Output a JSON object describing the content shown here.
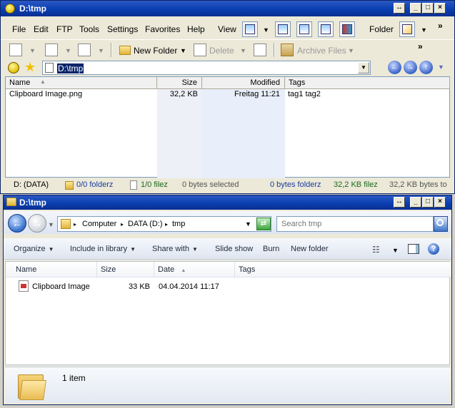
{
  "win1": {
    "title": "D:\\tmp",
    "menus": [
      "File",
      "Edit",
      "FTP",
      "Tools",
      "Settings",
      "Favorites",
      "Help",
      "View",
      "Folder"
    ],
    "toolbar": {
      "new_folder": "New Folder",
      "delete": "Delete",
      "archive_files": "Archive Files",
      "overflow": "»"
    },
    "address": {
      "path": "D:\\tmp"
    },
    "columns": [
      "Name",
      "Size",
      "Modified",
      "Tags"
    ],
    "rows": [
      {
        "name": "Clipboard Image.png",
        "size": "32,2 KB",
        "modified": "Freitag  11:21",
        "tags": "tag1 tag2"
      }
    ],
    "status": {
      "drive": "D: (DATA)",
      "folders": "0/0 folderz",
      "files": "1/0 filez",
      "selected": "0 bytes selected",
      "folder_bytes": "0 bytes folderz",
      "file_bytes": "32,2 KB filez",
      "total": "32,2 KB bytes to"
    }
  },
  "win2": {
    "title": "D:\\tmp",
    "breadcrumb": [
      "Computer",
      "DATA (D:)",
      "tmp"
    ],
    "search_placeholder": "Search tmp",
    "commands": {
      "organize": "Organize",
      "include": "Include in library",
      "share": "Share with",
      "slideshow": "Slide show",
      "burn": "Burn",
      "new_folder": "New folder"
    },
    "columns": [
      "Name",
      "Size",
      "Date",
      "Tags"
    ],
    "rows": [
      {
        "name": "Clipboard Image",
        "size": "33 KB",
        "date": "04.04.2014 11:17",
        "tags": ""
      }
    ],
    "details": {
      "count": "1 item"
    }
  }
}
